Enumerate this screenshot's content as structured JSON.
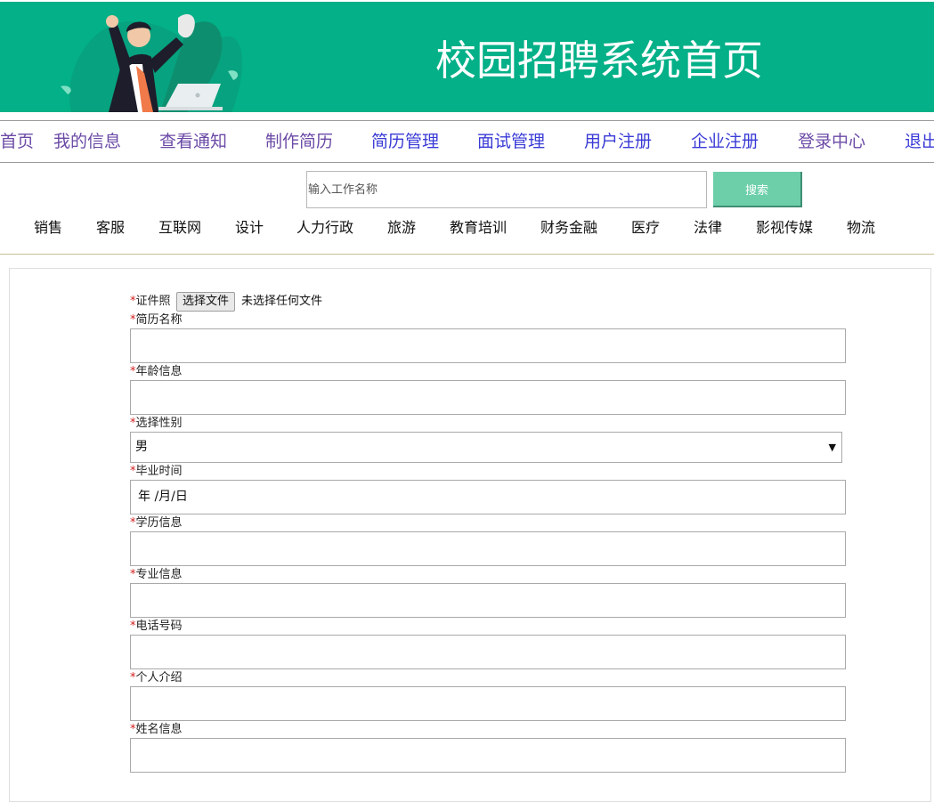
{
  "banner": {
    "title": "校园招聘系统首页",
    "background_color": "#03b088",
    "illustration": "businessman-with-laptop-illustration"
  },
  "nav": {
    "items": [
      {
        "label": "首页",
        "color": "#6b4aa6"
      },
      {
        "label": "我的信息",
        "color": "#6b4aa6"
      },
      {
        "label": "查看通知",
        "color": "#6b4aa6"
      },
      {
        "label": "制作简历",
        "color": "#6b4aa6"
      },
      {
        "label": "简历管理",
        "color": "#3a3bd6"
      },
      {
        "label": "面试管理",
        "color": "#3a3bd6"
      },
      {
        "label": "用户注册",
        "color": "#3a3bd6"
      },
      {
        "label": "企业注册",
        "color": "#3a3bd6"
      },
      {
        "label": "登录中心",
        "color": "#6b4aa6"
      },
      {
        "label": "退出",
        "color": "#3a3bd6"
      }
    ]
  },
  "search": {
    "placeholder": "输入工作名称",
    "button_label": "搜索"
  },
  "categories": [
    "销售",
    "客服",
    "互联网",
    "设计",
    "人力行政",
    "旅游",
    "教育培训",
    "财务金融",
    "医疗",
    "法律",
    "影视传媒",
    "物流"
  ],
  "form": {
    "required_mark": "*",
    "photo": {
      "label": "证件照",
      "button_label": "选择文件",
      "status": "未选择任何文件"
    },
    "resume_name": {
      "label": "简历名称",
      "value": ""
    },
    "age": {
      "label": "年龄信息",
      "value": ""
    },
    "gender": {
      "label": "选择性别",
      "selected": "男"
    },
    "graduation": {
      "label": "毕业时间",
      "value": "年 /月/日"
    },
    "education": {
      "label": "学历信息",
      "value": ""
    },
    "major": {
      "label": "专业信息",
      "value": ""
    },
    "phone": {
      "label": "电话号码",
      "value": ""
    },
    "intro": {
      "label": "个人介绍",
      "value": ""
    },
    "name": {
      "label": "姓名信息",
      "value": ""
    }
  }
}
